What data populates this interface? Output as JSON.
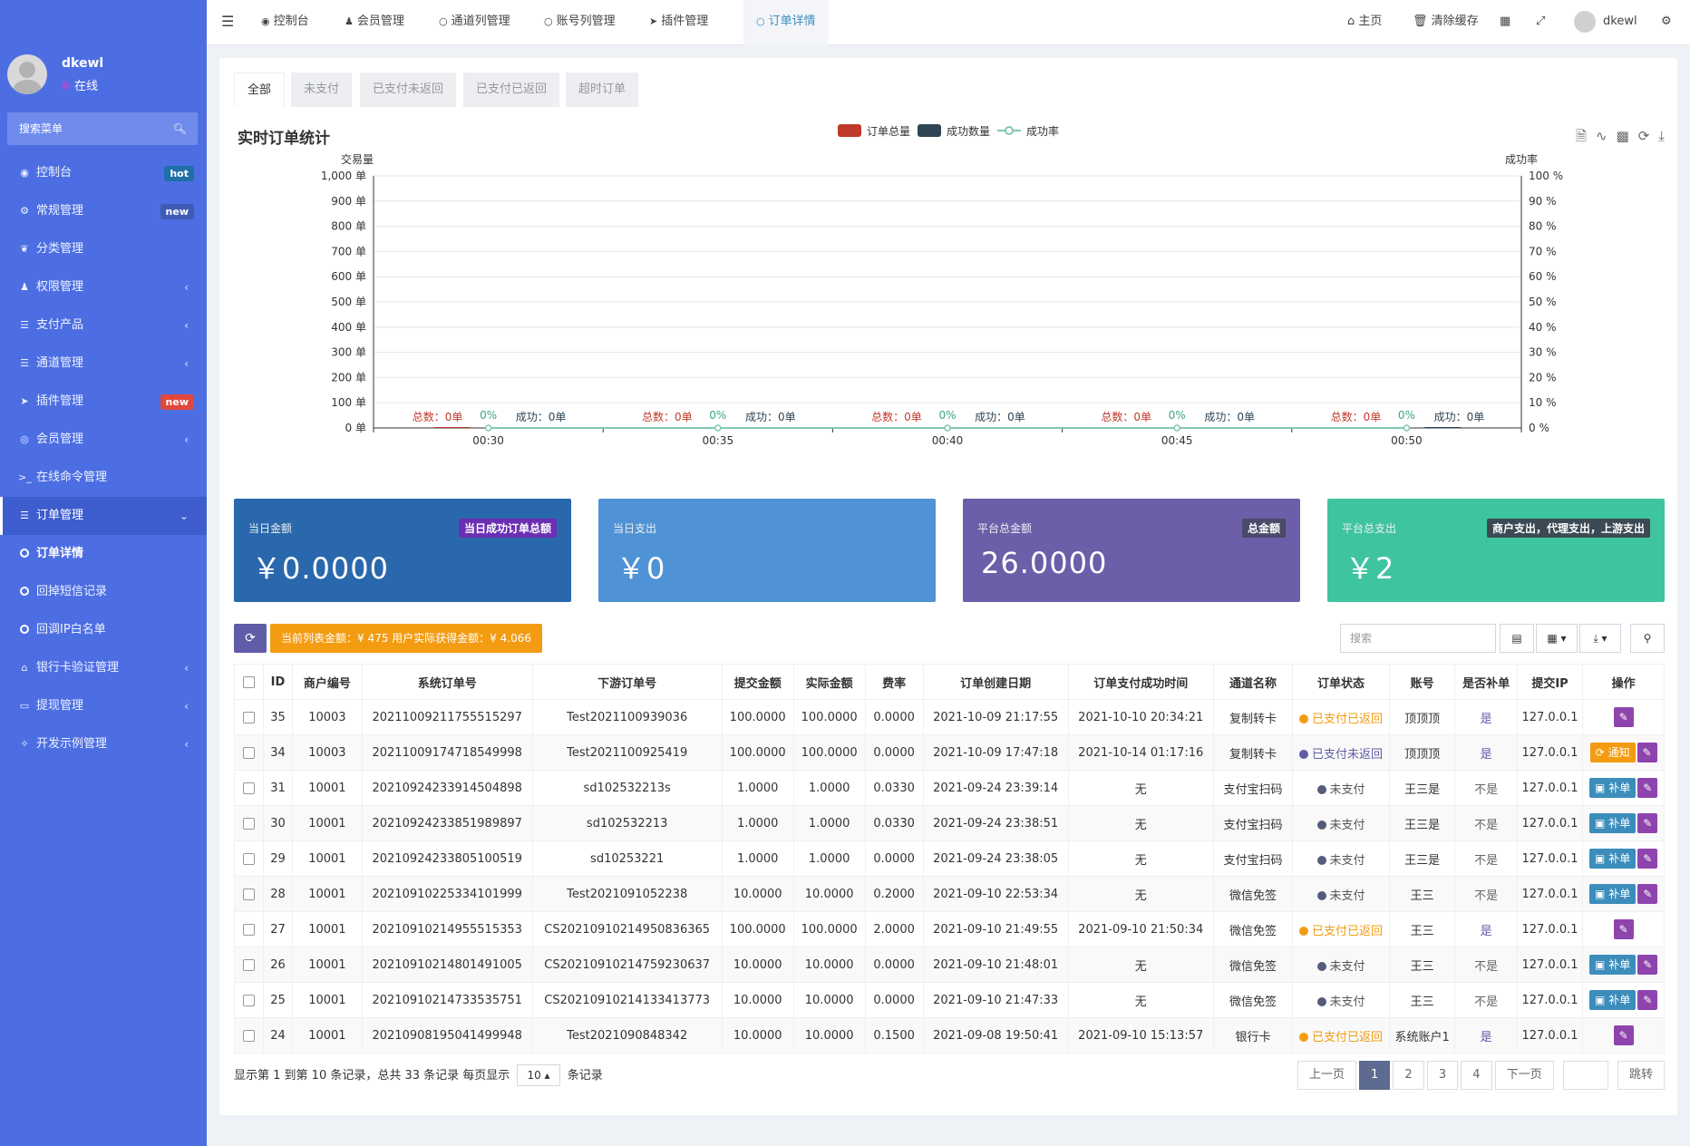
{
  "user": {
    "name": "dkewl",
    "status": "在线"
  },
  "sidebar": {
    "search_placeholder": "搜索菜单",
    "items": [
      {
        "label": "控制台",
        "icon": "dashboard-icon",
        "badge": "hot",
        "badge_color": "#1f6fa8"
      },
      {
        "label": "常规管理",
        "icon": "cogs-icon",
        "badge": "new",
        "badge_color": "#3f5bb5"
      },
      {
        "label": "分类管理",
        "icon": "leaf-icon"
      },
      {
        "label": "权限管理",
        "icon": "users-icon",
        "caret": "‹"
      },
      {
        "label": "支付产品",
        "icon": "list-icon",
        "caret": "‹"
      },
      {
        "label": "通道管理",
        "icon": "list-icon",
        "caret": "‹"
      },
      {
        "label": "插件管理",
        "icon": "rocket-icon",
        "badge": "new",
        "badge_color": "#e0483c"
      },
      {
        "label": "会员管理",
        "icon": "user-circle-icon",
        "caret": "‹"
      },
      {
        "label": "在线命令管理",
        "icon": "terminal-icon"
      },
      {
        "label": "订单管理",
        "icon": "list-icon",
        "caret": "⌄"
      },
      {
        "label": "订单详情",
        "sub": true
      },
      {
        "label": "回掉短信记录",
        "sub": true
      },
      {
        "label": "回调IP白名单",
        "sub": true
      },
      {
        "label": "银行卡验证管理",
        "icon": "bank-icon",
        "caret": "‹"
      },
      {
        "label": "提现管理",
        "icon": "credit-card-icon",
        "caret": "‹"
      },
      {
        "label": "开发示例管理",
        "icon": "magic-icon",
        "caret": "‹"
      }
    ]
  },
  "topbar": {
    "tabs": [
      "控制台",
      "会员管理",
      "通道列管理",
      "账号列管理",
      "插件管理",
      "订单详情"
    ],
    "home": "主页",
    "clear_cache": "清除缓存",
    "username": "dkewl"
  },
  "subtabs": [
    "全部",
    "未支付",
    "已支付未返回",
    "已支付已返回",
    "超时订单"
  ],
  "chart": {
    "title": "实时订单统计",
    "legend": [
      "订单总量",
      "成功数量",
      "成功率"
    ],
    "colors": {
      "total": "#c0392b",
      "success": "#2f4554",
      "rate": "#7fc7b5"
    }
  },
  "chart_data": {
    "type": "line",
    "title": "实时订单统计",
    "ylabel_left": "交易量",
    "ylabel_right": "成功率",
    "x": [
      "00:30",
      "00:35",
      "00:40",
      "00:45",
      "00:50"
    ],
    "y_left_ticks": [
      "0 单",
      "100 单",
      "200 单",
      "300 单",
      "400 单",
      "500 单",
      "600 单",
      "700 单",
      "800 单",
      "900 单",
      "1,000 单"
    ],
    "y_right_ticks": [
      "0 %",
      "10 %",
      "20 %",
      "30 %",
      "40 %",
      "50 %",
      "60 %",
      "70 %",
      "80 %",
      "90 %",
      "100 %"
    ],
    "ylim_left": [
      0,
      1000
    ],
    "ylim_right": [
      0,
      100
    ],
    "series": [
      {
        "name": "订单总量",
        "values": [
          0,
          0,
          0,
          0,
          0
        ],
        "label": "总数：0单"
      },
      {
        "name": "成功数量",
        "values": [
          0,
          0,
          0,
          0,
          0
        ],
        "label": "成功：0单"
      },
      {
        "name": "成功率",
        "values": [
          0,
          0,
          0,
          0,
          0
        ],
        "label": "0%"
      }
    ],
    "legend": "top-center",
    "grid": true
  },
  "cards": [
    {
      "label": "当日金额",
      "tag": "当日成功订单总额",
      "value": "￥0.0000",
      "bg": "#2a68ad",
      "tag_bg": "#6b2fb3"
    },
    {
      "label": "当日支出",
      "tag": "",
      "value": "￥0",
      "bg": "#4f93d6",
      "tag_bg": ""
    },
    {
      "label": "平台总金额",
      "tag": "总金额",
      "value": "26.0000",
      "bg": "#6a5fa8",
      "tag_bg": "#4a4a6a"
    },
    {
      "label": "平台总支出",
      "tag": "商户支出，代理支出，上游支出",
      "value": "￥2",
      "bg": "#3fc4a0",
      "tag_bg": "#3b4a54"
    }
  ],
  "toolbar": {
    "summary": "当前列表金额：¥ 475  用户实际获得金额：¥ 4.066",
    "search_placeholder": "搜索"
  },
  "table": {
    "headers": [
      "ID",
      "商户编号",
      "系统订单号",
      "下游订单号",
      "提交金额",
      "实际金额",
      "费率",
      "订单创建日期",
      "订单支付成功时间",
      "通道名称",
      "订单状态",
      "账号",
      "是否补单",
      "提交IP",
      "操作"
    ],
    "rows": [
      {
        "id": "35",
        "merchant": "10003",
        "sys_no": "20211009211755515297",
        "down_no": "Test2021100939036",
        "submit": "100.0000",
        "actual": "100.0000",
        "rate": "0.0000",
        "created": "2021-10-09 21:17:55",
        "paid": "2021-10-10 20:34:21",
        "channel": "复制转卡",
        "status": "已支付已返回",
        "status_type": "orange",
        "account": "顶顶顶",
        "fix": "是",
        "ip": "127.0.0.1",
        "actions": [
          "edit"
        ]
      },
      {
        "id": "34",
        "merchant": "10003",
        "sys_no": "20211009174718549998",
        "down_no": "Test2021100925419",
        "submit": "100.0000",
        "actual": "100.0000",
        "rate": "0.0000",
        "created": "2021-10-09 17:47:18",
        "paid": "2021-10-14 01:17:16",
        "channel": "复制转卡",
        "status": "已支付未返回",
        "status_type": "purple",
        "account": "顶顶顶",
        "fix": "是",
        "ip": "127.0.0.1",
        "actions": [
          "notify",
          "edit"
        ]
      },
      {
        "id": "31",
        "merchant": "10001",
        "sys_no": "20210924233914504898",
        "down_no": "sd102532213s",
        "submit": "1.0000",
        "actual": "1.0000",
        "rate": "0.0330",
        "created": "2021-09-24 23:39:14",
        "paid": "无",
        "channel": "支付宝扫码",
        "status": "未支付",
        "status_type": "gray",
        "account": "王三是",
        "fix": "不是",
        "ip": "127.0.0.1",
        "actions": [
          "fix",
          "edit"
        ]
      },
      {
        "id": "30",
        "merchant": "10001",
        "sys_no": "20210924233851989897",
        "down_no": "sd102532213",
        "submit": "1.0000",
        "actual": "1.0000",
        "rate": "0.0330",
        "created": "2021-09-24 23:38:51",
        "paid": "无",
        "channel": "支付宝扫码",
        "status": "未支付",
        "status_type": "gray",
        "account": "王三是",
        "fix": "不是",
        "ip": "127.0.0.1",
        "actions": [
          "fix",
          "edit"
        ]
      },
      {
        "id": "29",
        "merchant": "10001",
        "sys_no": "20210924233805100519",
        "down_no": "sd10253221",
        "submit": "1.0000",
        "actual": "1.0000",
        "rate": "0.0000",
        "created": "2021-09-24 23:38:05",
        "paid": "无",
        "channel": "支付宝扫码",
        "status": "未支付",
        "status_type": "gray",
        "account": "王三是",
        "fix": "不是",
        "ip": "127.0.0.1",
        "actions": [
          "fix",
          "edit"
        ]
      },
      {
        "id": "28",
        "merchant": "10001",
        "sys_no": "20210910225334101999",
        "down_no": "Test2021091052238",
        "submit": "10.0000",
        "actual": "10.0000",
        "rate": "0.2000",
        "created": "2021-09-10 22:53:34",
        "paid": "无",
        "channel": "微信免签",
        "status": "未支付",
        "status_type": "gray",
        "account": "王三",
        "fix": "不是",
        "ip": "127.0.0.1",
        "actions": [
          "fix",
          "edit"
        ]
      },
      {
        "id": "27",
        "merchant": "10001",
        "sys_no": "20210910214955515353",
        "down_no": "CS20210910214950836365",
        "submit": "100.0000",
        "actual": "100.0000",
        "rate": "2.0000",
        "created": "2021-09-10 21:49:55",
        "paid": "2021-09-10 21:50:34",
        "channel": "微信免签",
        "status": "已支付已返回",
        "status_type": "orange",
        "account": "王三",
        "fix": "是",
        "ip": "127.0.0.1",
        "actions": [
          "edit"
        ]
      },
      {
        "id": "26",
        "merchant": "10001",
        "sys_no": "20210910214801491005",
        "down_no": "CS20210910214759230637",
        "submit": "10.0000",
        "actual": "10.0000",
        "rate": "0.0000",
        "created": "2021-09-10 21:48:01",
        "paid": "无",
        "channel": "微信免签",
        "status": "未支付",
        "status_type": "gray",
        "account": "王三",
        "fix": "不是",
        "ip": "127.0.0.1",
        "actions": [
          "fix",
          "edit"
        ]
      },
      {
        "id": "25",
        "merchant": "10001",
        "sys_no": "20210910214733535751",
        "down_no": "CS20210910214133413773",
        "submit": "10.0000",
        "actual": "10.0000",
        "rate": "0.0000",
        "created": "2021-09-10 21:47:33",
        "paid": "无",
        "channel": "微信免签",
        "status": "未支付",
        "status_type": "gray",
        "account": "王三",
        "fix": "不是",
        "ip": "127.0.0.1",
        "actions": [
          "fix",
          "edit"
        ]
      },
      {
        "id": "24",
        "merchant": "10001",
        "sys_no": "20210908195041499948",
        "down_no": "Test2021090848342",
        "submit": "10.0000",
        "actual": "10.0000",
        "rate": "0.1500",
        "created": "2021-09-08 19:50:41",
        "paid": "2021-09-10 15:13:57",
        "channel": "银行卡",
        "status": "已支付已返回",
        "status_type": "orange",
        "account": "系统账户1",
        "fix": "是",
        "ip": "127.0.0.1",
        "actions": [
          "edit"
        ]
      }
    ],
    "action_labels": {
      "fix": "补单",
      "notify": "通知"
    }
  },
  "pagination": {
    "info_prefix": "显示第 1 到第 10 条记录，总共 33 条记录 每页显示",
    "page_size": "10",
    "info_suffix": "条记录",
    "prev": "上一页",
    "pages": [
      "1",
      "2",
      "3",
      "4"
    ],
    "current": "1",
    "next": "下一页",
    "jump": "跳转"
  }
}
